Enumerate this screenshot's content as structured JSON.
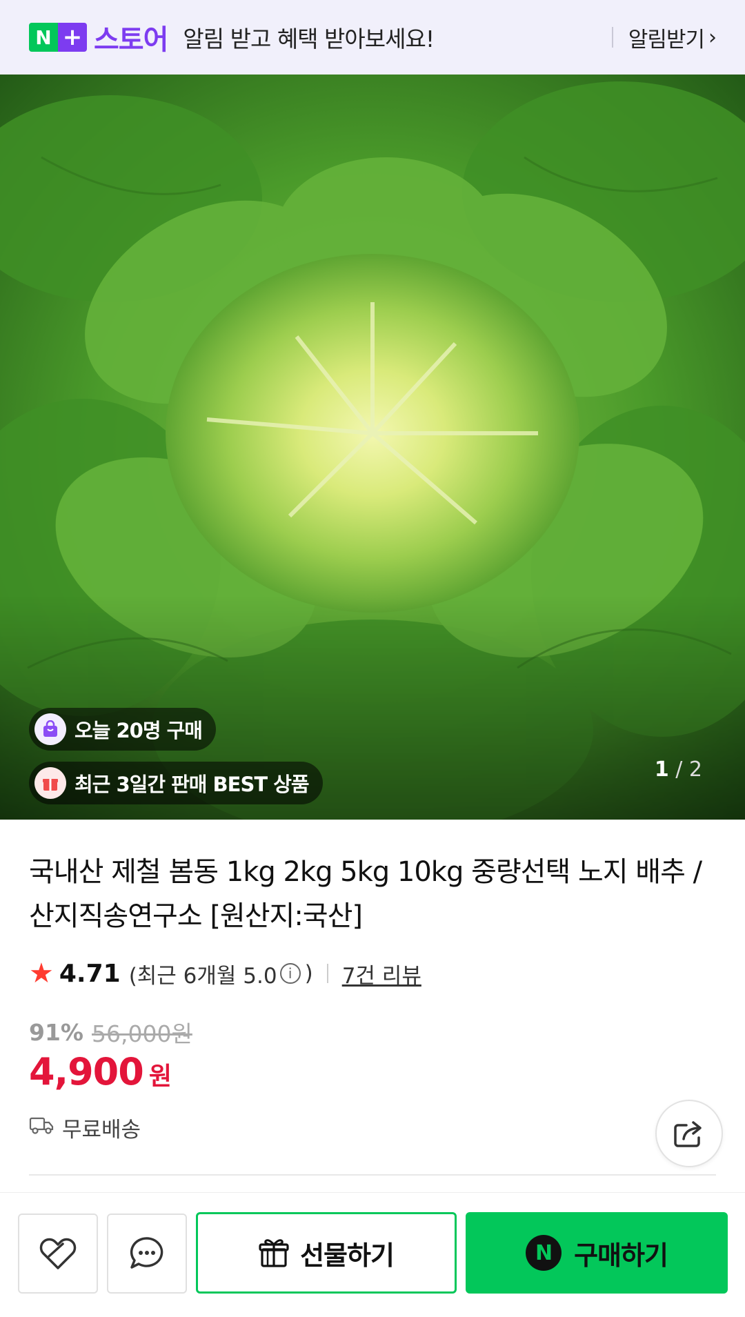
{
  "banner": {
    "logo_n": "N",
    "logo_plus": "+",
    "logo_text": "스토어",
    "message": "알림 받고 혜택 받아보세요!",
    "action_label": "알림받기",
    "action_chevron": "›"
  },
  "hero": {
    "badges": [
      {
        "icon": "shopping-bag-icon",
        "text": "오늘 20명 구매"
      },
      {
        "icon": "gift-box-icon",
        "text": "최근 3일간 판매 BEST 상품"
      }
    ],
    "page_current": "1",
    "page_total": "2",
    "page_sep": "/"
  },
  "product": {
    "title": "국내산 제철 봄동 1kg 2kg 5kg 10kg 중량선택 노지 배추 / 산지직송연구소 [원산지:국산]",
    "rating": {
      "star": "★",
      "value": "4.71",
      "recent_prefix": "(최근 6개월 5.0",
      "info_symbol": "i",
      "recent_suffix": ")",
      "review_link": "7건 리뷰"
    },
    "discount_rate": "91%",
    "original_price": "56,000원",
    "price": "4,900",
    "currency": "원",
    "shipping": "무료배송"
  },
  "actions": {
    "gift_label": "선물하기",
    "npay_mark": "N",
    "buy_label": "구매하기"
  },
  "colors": {
    "accent_green": "#03c75a",
    "brand_purple": "#7d3cf0",
    "price_red": "#e3153a",
    "banner_bg": "#f1f0fb"
  }
}
